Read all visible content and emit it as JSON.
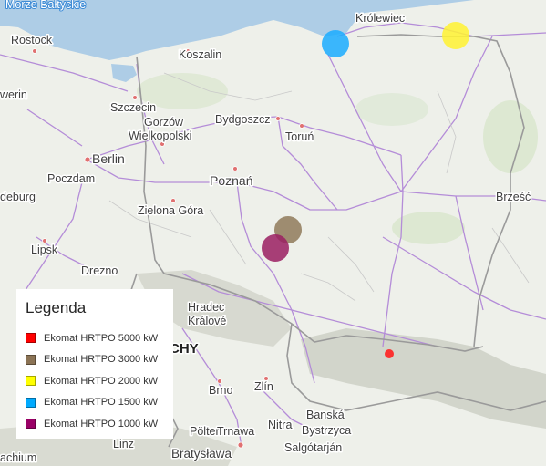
{
  "map": {
    "places": [
      {
        "name": "Morze Bałtyckie",
        "kind": "sea"
      },
      {
        "name": "Rostock"
      },
      {
        "name": "Koszalin"
      },
      {
        "name": "Królewiec"
      },
      {
        "name": "Szczecin"
      },
      {
        "name": "Gorzów"
      },
      {
        "name": "Wielkopolski"
      },
      {
        "name": "Bydgoszcz"
      },
      {
        "name": "Toruń"
      },
      {
        "name": "Berlin"
      },
      {
        "name": "Poczdam"
      },
      {
        "name": "Poznań"
      },
      {
        "name": "Zielona Góra"
      },
      {
        "name": "Brześć"
      },
      {
        "name": "Lipsk"
      },
      {
        "name": "Drezno"
      },
      {
        "name": "Hradec"
      },
      {
        "name": "Králové"
      },
      {
        "name": "CHY",
        "kind": "country"
      },
      {
        "name": "Brno"
      },
      {
        "name": "Zlín"
      },
      {
        "name": "Banská"
      },
      {
        "name": "Bystrzyca"
      },
      {
        "name": "Nitra"
      },
      {
        "name": "Salgótarján"
      },
      {
        "name": "Pölten"
      },
      {
        "name": "Trnawa"
      },
      {
        "name": "Bratysława"
      },
      {
        "name": "Linz"
      },
      {
        "name": "achium"
      },
      {
        "name": "werin"
      },
      {
        "name": "deburg"
      }
    ],
    "markers": [
      {
        "category": "Ekomat HRTPO 1500 kW",
        "color": "#1AABFF"
      },
      {
        "category": "Ekomat HRTPO 2000 kW",
        "color": "#FFF231"
      },
      {
        "category": "Ekomat HRTPO 3000 kW",
        "color": "#8F7A5A"
      },
      {
        "category": "Ekomat HRTPO 1000 kW",
        "color": "#9A1E61"
      },
      {
        "category": "Ekomat HRTPO 5000 kW",
        "color": "#FF2020"
      }
    ]
  },
  "legend": {
    "title": "Legenda",
    "items": [
      {
        "label": "Ekomat HRTPO 5000 kW",
        "color": "#FF0000"
      },
      {
        "label": "Ekomat HRTPO 3000 kW",
        "color": "#8B7355"
      },
      {
        "label": "Ekomat HRTPO 2000 kW",
        "color": "#FFFF00"
      },
      {
        "label": "Ekomat HRTPO 1500 kW",
        "color": "#00AAFF"
      },
      {
        "label": "Ekomat HRTPO 1000 kW",
        "color": "#990066"
      }
    ]
  }
}
